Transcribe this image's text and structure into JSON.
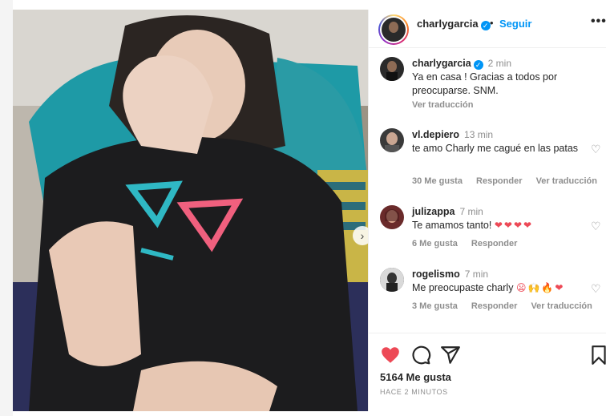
{
  "post": {
    "author": "charlygarcia",
    "follow_label": "Seguir",
    "separator": "•",
    "more_label": "•••",
    "verified_mark": "✓",
    "next_arrow": "›"
  },
  "caption": {
    "user": "charlygarcia",
    "time": "2 min",
    "text": "Ya en casa ! Gracias a todos por preocuparse. SNM.",
    "translate_label": "Ver traducción"
  },
  "comments": [
    {
      "user": "vl.depiero",
      "time": "13 min",
      "text": "te amo Charly me cagué en las patas",
      "likes": "30 Me gusta",
      "reply": "Responder",
      "translate": "Ver traducción"
    },
    {
      "user": "julizappa",
      "time": "7 min",
      "text": "Te amamos tanto!",
      "emoji": "❤❤❤❤",
      "likes": "6 Me gusta",
      "reply": "Responder"
    },
    {
      "user": "rogelismo",
      "time": "7 min",
      "text": "Me preocupaste charly",
      "emoji": "😦🙌🔥❤",
      "likes": "3 Me gusta",
      "reply": "Responder",
      "translate": "Ver traducción"
    }
  ],
  "footer": {
    "likes": "5164 Me gusta",
    "ago": "HACE 2 MINUTOS"
  },
  "icons": {
    "like": "heart-icon",
    "comment": "comment-icon",
    "share": "share-icon",
    "save": "bookmark-icon"
  },
  "colors": {
    "accent": "#0095f6",
    "like": "#ed4956",
    "muted": "#8e8e8e"
  }
}
